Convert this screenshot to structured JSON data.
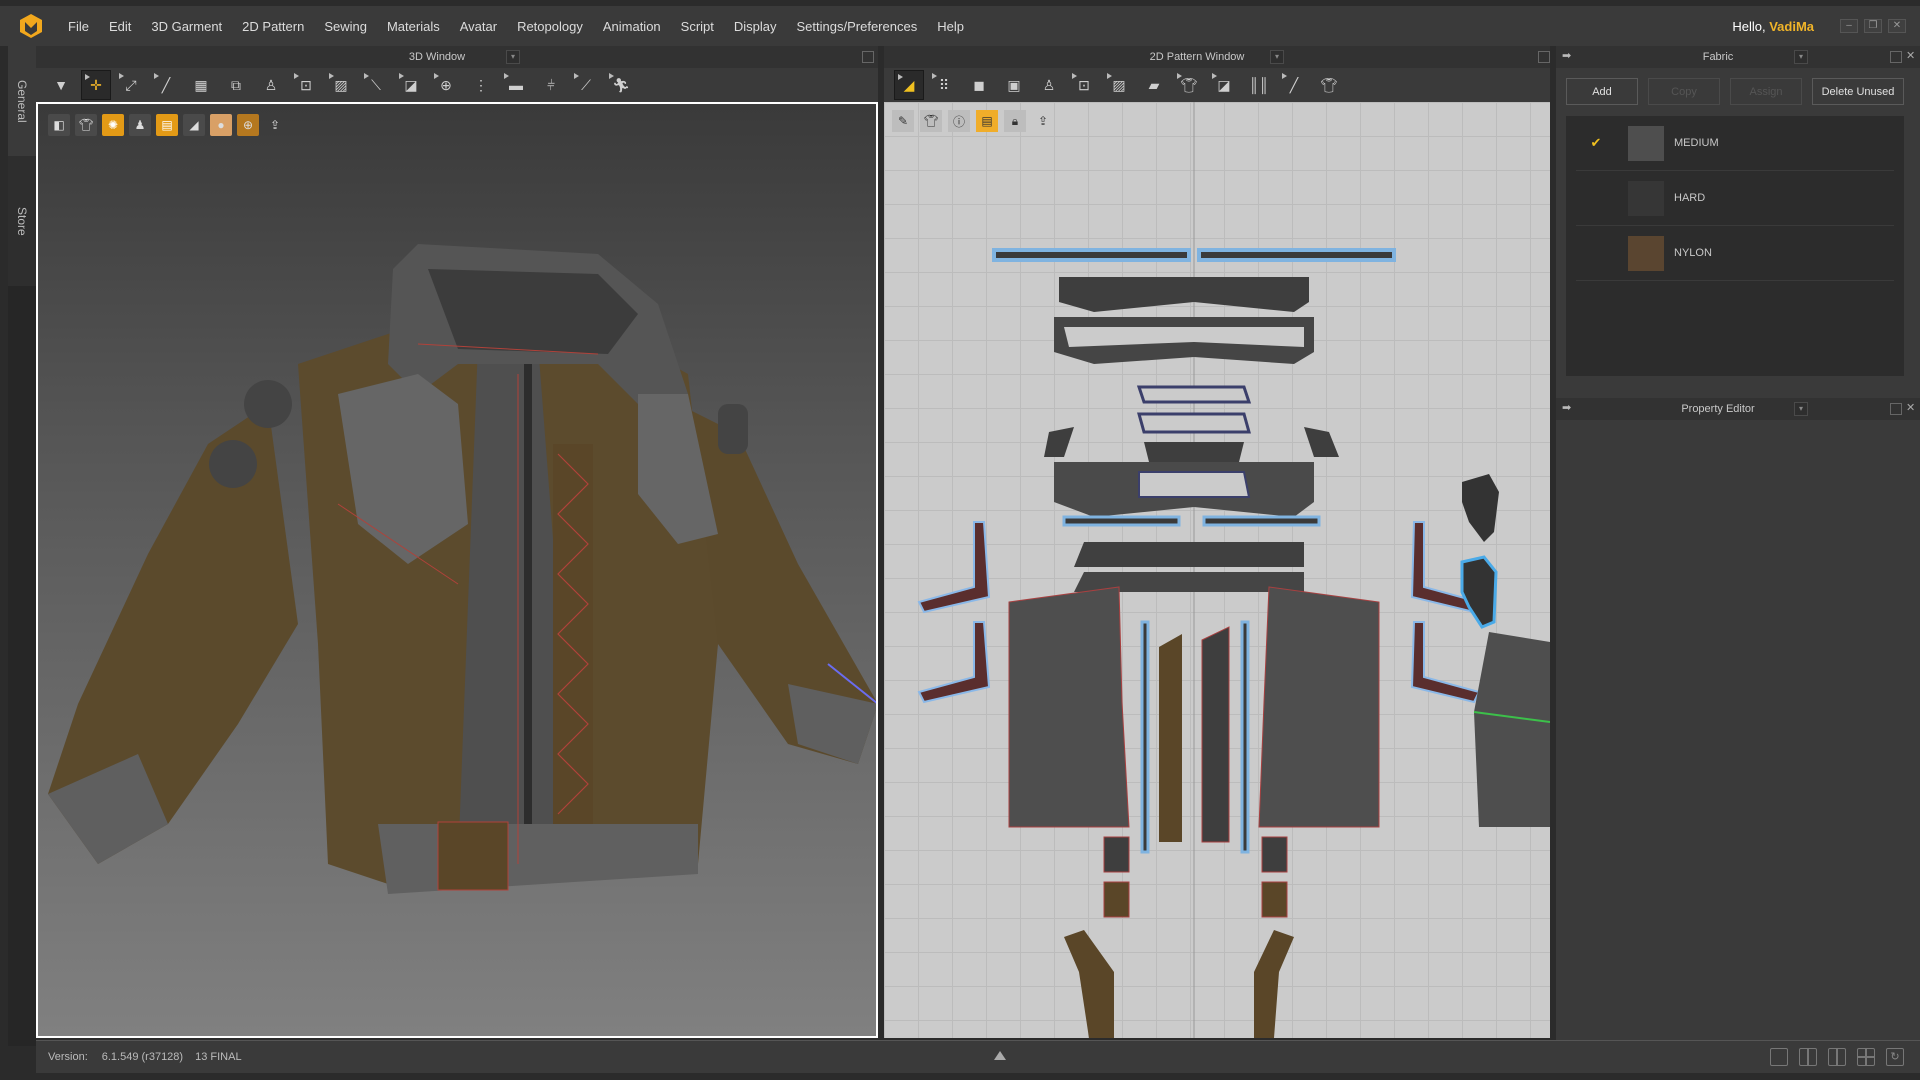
{
  "app": {
    "menu": [
      "File",
      "Edit",
      "3D Garment",
      "2D Pattern",
      "Sewing",
      "Materials",
      "Avatar",
      "Retopology",
      "Animation",
      "Script",
      "Display",
      "Settings/Preferences",
      "Help"
    ],
    "greeting_prefix": "Hello,",
    "user_name": "VadiMa",
    "accent": "#f0b429"
  },
  "side_tabs": {
    "general": "General",
    "store": "Store"
  },
  "window3d": {
    "title": "3D Window",
    "tools": [
      "avatar-drop-icon",
      "transform-icon",
      "select-mesh-icon",
      "pin-icon",
      "garment-fold-icon",
      "arrangement-icon",
      "avatar-pose-icon",
      "sew-icon",
      "tuck-icon",
      "tack-icon",
      "zipper-icon",
      "button-icon",
      "puckering-icon",
      "elastic-icon",
      "measure-icon",
      "walk-icon"
    ],
    "view_icons": [
      "texture-view-icon",
      "garment-view-icon",
      "particles-icon",
      "avatar-view-icon",
      "fabric-view-icon",
      "mesh-shading-icon",
      "skin-icon",
      "globe-icon",
      "export-icon"
    ]
  },
  "window2d": {
    "title": "2D Pattern Window",
    "tools": [
      "edit-pattern-icon",
      "edit-point-icon",
      "polygon-icon",
      "rectangle-icon",
      "arrangement-icon",
      "sew-icon",
      "tuck-icon",
      "iron-icon",
      "fold-icon",
      "tack-icon",
      "pleat-icon",
      "internal-line-icon",
      "garment-icon"
    ],
    "view_icons": [
      "ruler-view-icon",
      "pattern-view-icon",
      "info-icon",
      "fabric-view-icon",
      "lock-pattern-icon",
      "export-icon"
    ]
  },
  "fabric_panel": {
    "title": "Fabric",
    "buttons": {
      "add": "Add",
      "copy": "Copy",
      "assign": "Assign",
      "delete_unused": "Delete Unused"
    },
    "items": [
      {
        "name": "MEDIUM",
        "color": "#4e4e4e",
        "selected": true
      },
      {
        "name": "HARD",
        "color": "#363636",
        "selected": false
      },
      {
        "name": "NYLON",
        "color": "#5a4530",
        "selected": false
      }
    ],
    "check": "✔"
  },
  "property_editor": {
    "title": "Property Editor"
  },
  "status": {
    "version_label": "Version:",
    "version": "6.1.549 (r37128)",
    "build": "13 FINAL"
  },
  "layouts": [
    "single-view-icon",
    "split-view-icon",
    "three-pane-icon",
    "quad-view-icon",
    "rotate-view-icon"
  ]
}
